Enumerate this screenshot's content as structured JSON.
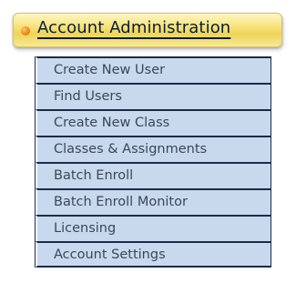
{
  "header": {
    "title": "Account Administration"
  },
  "menu": {
    "items": [
      {
        "label": "Create New User"
      },
      {
        "label": "Find Users"
      },
      {
        "label": "Create New Class"
      },
      {
        "label": "Classes & Assignments"
      },
      {
        "label": "Batch Enroll"
      },
      {
        "label": "Batch Enroll Monitor"
      },
      {
        "label": "Licensing"
      },
      {
        "label": "Account Settings"
      }
    ]
  }
}
